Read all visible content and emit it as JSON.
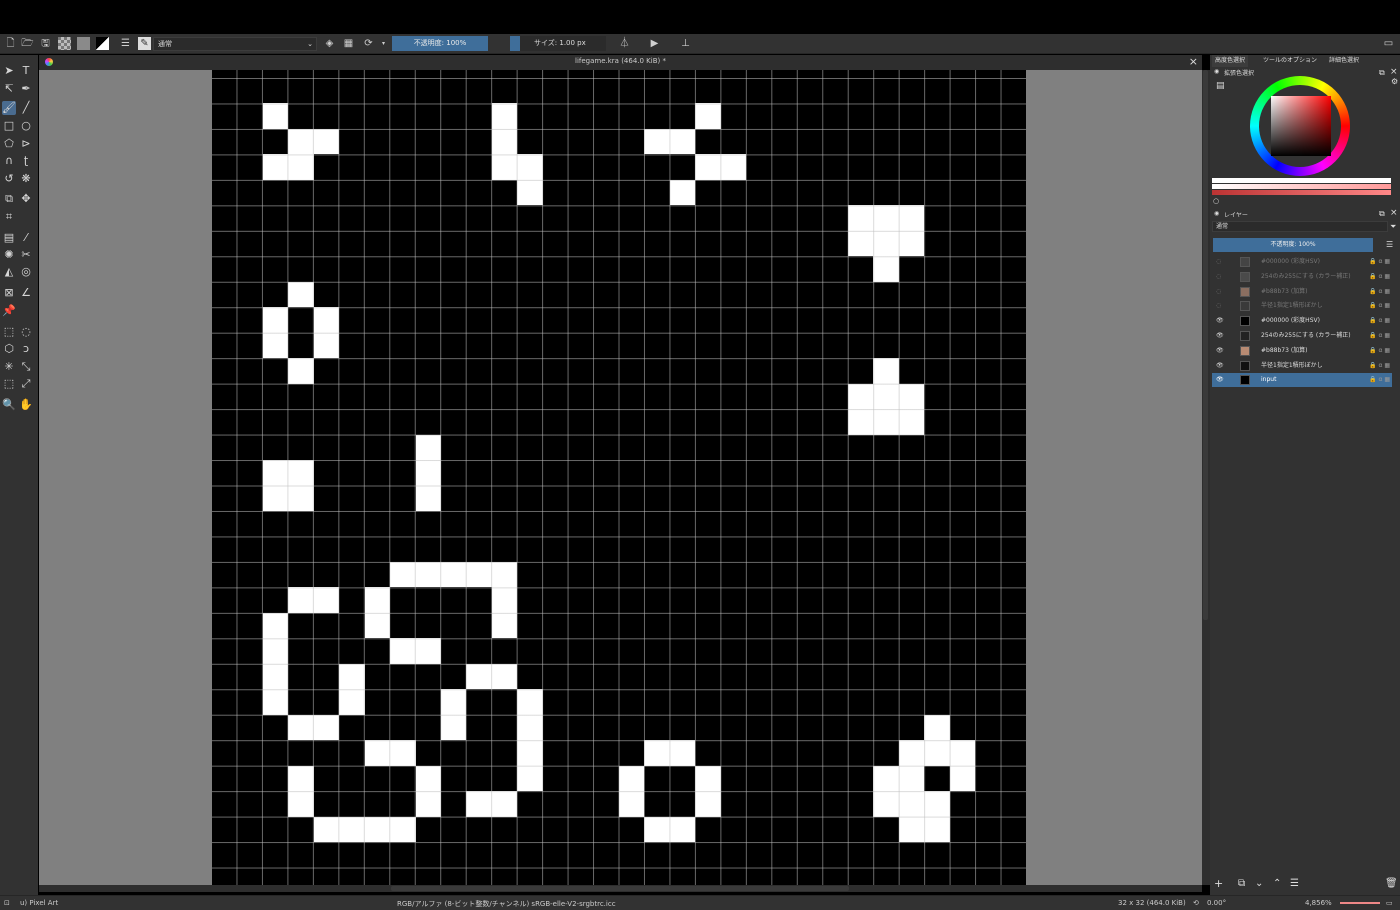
{
  "document": {
    "title": "lifegame.kra (464.0 KiB) *"
  },
  "toolbar": {
    "blend_mode": "通常",
    "opacity_label": "不透明度: 100%",
    "size_label": "サイズ: 1.00 px"
  },
  "dock": {
    "tabs": [
      "高度色選択",
      "ツールのオプション",
      "詳細色選択"
    ],
    "color_panel_title": "拡張色選択",
    "layers_title": "レイヤー",
    "layers_blend": "通常",
    "layers_opacity": "不透明度: 100%",
    "layers": [
      {
        "name": "#000000 (彩度HSV)",
        "visible": false,
        "thumb": "#444444"
      },
      {
        "name": "254のみ255にする (カラー補正)",
        "visible": false,
        "thumb": "#4a4a4a"
      },
      {
        "name": "#b88b73 (加算)",
        "visible": false,
        "thumb": "#8a6e60"
      },
      {
        "name": "半径1指定1積形ぼかし",
        "visible": false,
        "thumb": "#3a3a3a"
      },
      {
        "name": "#000000 (彩度HSV)",
        "visible": true,
        "thumb": "#000000"
      },
      {
        "name": "254のみ255にする (カラー補正)",
        "visible": true,
        "thumb": "#222222"
      },
      {
        "name": "#b88b73 (加算)",
        "visible": true,
        "thumb": "#b88b73"
      },
      {
        "name": "半径1指定1積形ぼかし",
        "visible": true,
        "thumb": "#111111"
      },
      {
        "name": "input",
        "visible": true,
        "thumb": "#000000",
        "selected": true
      }
    ]
  },
  "status": {
    "brush": "u) Pixel Art",
    "color_info": "RGB/アルファ (8-ビット整数/チャンネル)  sRGB-elle-V2-srgbtrc.icc",
    "image_size": "32 x 32 (464.0 KiB)",
    "rotation": "0.00°",
    "zoom": "4,856%"
  },
  "colors": {
    "accent": "#3f6e9a",
    "canvas_bg": "#808080",
    "panel_bg": "#323232"
  },
  "grid": {
    "width": 32,
    "height": 32,
    "alive_cells": [
      [
        2,
        1
      ],
      [
        11,
        1
      ],
      [
        19,
        1
      ],
      [
        3,
        2
      ],
      [
        4,
        2
      ],
      [
        11,
        2
      ],
      [
        17,
        2
      ],
      [
        18,
        2
      ],
      [
        2,
        3
      ],
      [
        3,
        3
      ],
      [
        11,
        3
      ],
      [
        12,
        3
      ],
      [
        19,
        3
      ],
      [
        20,
        3
      ],
      [
        12,
        4
      ],
      [
        18,
        4
      ],
      [
        25,
        5
      ],
      [
        26,
        5
      ],
      [
        27,
        5
      ],
      [
        25,
        6
      ],
      [
        26,
        6
      ],
      [
        27,
        6
      ],
      [
        26,
        7
      ],
      [
        3,
        8
      ],
      [
        2,
        9
      ],
      [
        4,
        9
      ],
      [
        2,
        10
      ],
      [
        4,
        10
      ],
      [
        3,
        11
      ],
      [
        26,
        11
      ],
      [
        25,
        12
      ],
      [
        26,
        12
      ],
      [
        27,
        12
      ],
      [
        25,
        13
      ],
      [
        26,
        13
      ],
      [
        27,
        13
      ],
      [
        8,
        14
      ],
      [
        2,
        15
      ],
      [
        3,
        15
      ],
      [
        8,
        15
      ],
      [
        2,
        16
      ],
      [
        3,
        16
      ],
      [
        8,
        16
      ],
      [
        7,
        19
      ],
      [
        8,
        19
      ],
      [
        9,
        19
      ],
      [
        10,
        19
      ],
      [
        11,
        19
      ],
      [
        3,
        20
      ],
      [
        4,
        20
      ],
      [
        6,
        20
      ],
      [
        11,
        20
      ],
      [
        2,
        21
      ],
      [
        6,
        21
      ],
      [
        11,
        21
      ],
      [
        2,
        22
      ],
      [
        7,
        22
      ],
      [
        8,
        22
      ],
      [
        2,
        23
      ],
      [
        5,
        23
      ],
      [
        10,
        23
      ],
      [
        11,
        23
      ],
      [
        2,
        24
      ],
      [
        5,
        24
      ],
      [
        9,
        24
      ],
      [
        12,
        24
      ],
      [
        3,
        25
      ],
      [
        4,
        25
      ],
      [
        9,
        25
      ],
      [
        12,
        25
      ],
      [
        28,
        25
      ],
      [
        6,
        26
      ],
      [
        7,
        26
      ],
      [
        12,
        26
      ],
      [
        17,
        26
      ],
      [
        18,
        26
      ],
      [
        27,
        26
      ],
      [
        28,
        26
      ],
      [
        29,
        26
      ],
      [
        3,
        27
      ],
      [
        8,
        27
      ],
      [
        12,
        27
      ],
      [
        16,
        27
      ],
      [
        19,
        27
      ],
      [
        26,
        27
      ],
      [
        27,
        27
      ],
      [
        29,
        27
      ],
      [
        3,
        28
      ],
      [
        8,
        28
      ],
      [
        10,
        28
      ],
      [
        11,
        28
      ],
      [
        16,
        28
      ],
      [
        19,
        28
      ],
      [
        26,
        28
      ],
      [
        27,
        28
      ],
      [
        28,
        28
      ],
      [
        4,
        29
      ],
      [
        5,
        29
      ],
      [
        6,
        29
      ],
      [
        7,
        29
      ],
      [
        17,
        29
      ],
      [
        18,
        29
      ],
      [
        27,
        29
      ],
      [
        28,
        29
      ]
    ]
  }
}
